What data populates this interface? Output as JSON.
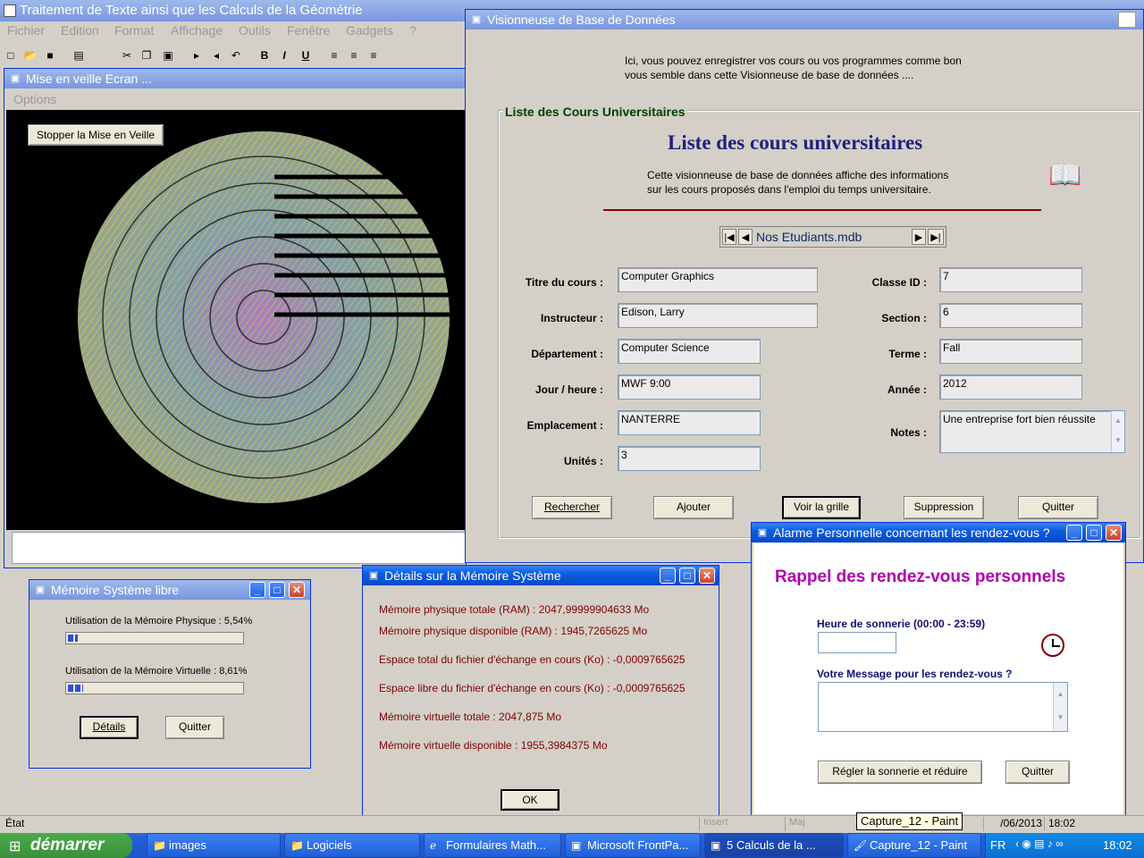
{
  "main": {
    "title": "Traitement de Texte ainsi que les Calculs de la Géométrie",
    "menu": [
      "Fichier",
      "Edition",
      "Format",
      "Affichage",
      "Outils",
      "Fenêtre",
      "Gadgets",
      "?"
    ],
    "status": "État"
  },
  "screensaver": {
    "title": "Mise en veille Ecran ...",
    "menu": "Options",
    "stop_label": "Stopper la Mise en Veille"
  },
  "db": {
    "title": "Visionneuse de Base de Données",
    "intro_1": "Ici, vous pouvez enregistrer vos cours ou vos programmes comme bon",
    "intro_2": "vous semble dans cette Visionneuse de base de données ....",
    "group_label": "Liste des Cours Universitaires",
    "heading": "Liste des cours universitaires",
    "desc_1": "Cette visionneuse de base de données affiche des informations",
    "desc_2": "sur les cours proposés dans l'emploi du temps universitaire.",
    "nav_text": "Nos Etudiants.mdb",
    "fields": {
      "titre_label": "Titre du cours :",
      "titre": "Computer Graphics",
      "instructeur_label": "Instructeur :",
      "instructeur": "Edison, Larry",
      "departement_label": "Département :",
      "departement": "Computer Science",
      "jour_label": "Jour / heure :",
      "jour": "MWF 9:00",
      "emplacement_label": "Emplacement :",
      "emplacement": "NANTERRE",
      "unites_label": "Unités :",
      "unites": "3",
      "classe_label": "Classe ID :",
      "classe": "7",
      "section_label": "Section :",
      "section": "6",
      "terme_label": "Terme :",
      "terme": "Fall",
      "annee_label": "Année :",
      "annee": "2012",
      "notes_label": "Notes :",
      "notes": "Une entreprise fort bien réussite"
    },
    "buttons": {
      "rechercher": "Rechercher",
      "ajouter": "Ajouter",
      "voir": "Voir la grille",
      "suppression": "Suppression",
      "quitter": "Quitter"
    }
  },
  "memory_free": {
    "title": "Mémoire Système libre",
    "physical_label": "Utilisation de la Mémoire Physique : 5,54%",
    "physical_pct": 5.54,
    "virtual_label": "Utilisation de la Mémoire Virtuelle : 8,61%",
    "virtual_pct": 8.61,
    "details": "Détails",
    "quit": "Quitter"
  },
  "memory_details": {
    "title": "Détails sur la Mémoire Système",
    "lines": [
      "Mémoire physique totale (RAM) : 2047,99999904633 Mo",
      "Mémoire physique disponible (RAM) : 1945,7265625 Mo",
      "Espace total du fichier d'échange en cours (Ko) : -0,0009765625",
      "Espace libre du fichier d'échange en cours (Ko) : -0,0009765625",
      "Mémoire virtuelle totale : 2047,875 Mo",
      "Mémoire virtuelle disponible : 1955,3984375 Mo"
    ],
    "ok": "OK"
  },
  "alarm": {
    "title": "Alarme Personnelle concernant les rendez-vous ?",
    "heading": "Rappel des rendez-vous personnels",
    "time_label": "Heure de sonnerie (00:00 - 23:59)",
    "message_label": "Votre Message pour les rendez-vous ?",
    "set_button": "Régler la sonnerie et réduire",
    "quit": "Quitter"
  },
  "statusbar": {
    "insert": "Insert",
    "maj": "Maj",
    "date": "/06/2013",
    "time": "18:02",
    "tooltip": "Capture_12 - Paint"
  },
  "taskbar": {
    "start": "démarrer",
    "items": [
      "images",
      "Logiciels",
      "Formulaires Math...",
      "Microsoft FrontPa...",
      "5 Calculs de la ...",
      "Capture_12 - Paint"
    ],
    "lang": "FR",
    "clock": "18:02"
  }
}
